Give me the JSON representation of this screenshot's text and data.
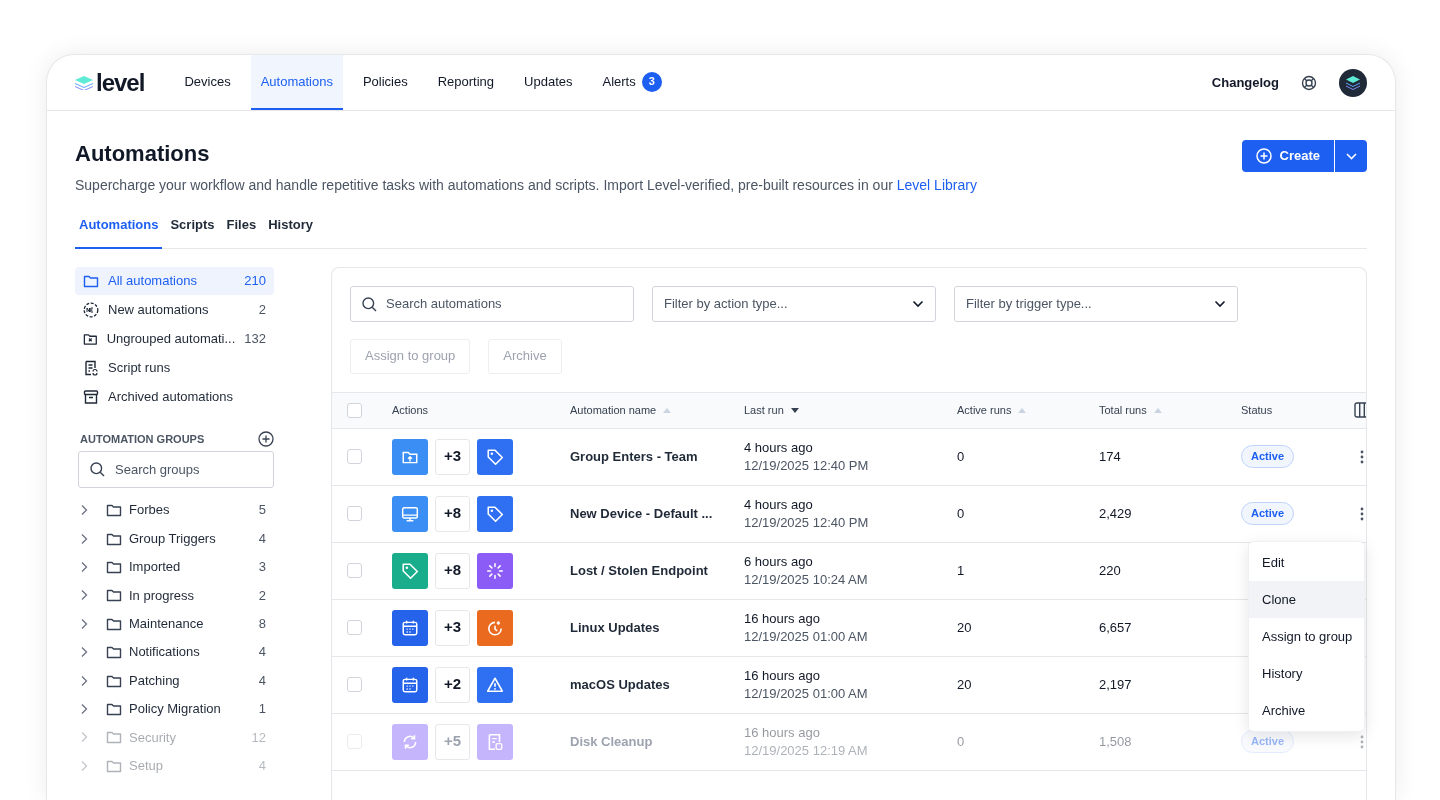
{
  "logo": {
    "text": "level"
  },
  "nav": {
    "items": [
      {
        "label": "Devices",
        "selected": false
      },
      {
        "label": "Automations",
        "selected": true
      },
      {
        "label": "Policies",
        "selected": false
      },
      {
        "label": "Reporting",
        "selected": false
      },
      {
        "label": "Updates",
        "selected": false
      },
      {
        "label": "Alerts",
        "selected": false,
        "badge": "3"
      }
    ],
    "changelog": "Changelog"
  },
  "header": {
    "title": "Automations",
    "subtitle": "Supercharge your workflow and handle repetitive tasks with automations and scripts. Import Level-verified, pre-built resources in our ",
    "link": "Level Library",
    "create": "Create"
  },
  "tabs": [
    {
      "label": "Automations",
      "selected": true
    },
    {
      "label": "Scripts",
      "selected": false
    },
    {
      "label": "Files",
      "selected": false
    },
    {
      "label": "History",
      "selected": false
    }
  ],
  "sidebar": {
    "items": [
      {
        "label": "All automations",
        "count": "210",
        "selected": true,
        "kind": "folder"
      },
      {
        "label": "New automations",
        "count": "2",
        "selected": false,
        "kind": "new"
      },
      {
        "label": "Ungrouped automati...",
        "count": "132",
        "selected": false,
        "kind": "ungrouped"
      },
      {
        "label": "Script runs",
        "selected": false,
        "kind": "script"
      },
      {
        "label": "Archived automations",
        "selected": false,
        "kind": "archive"
      }
    ],
    "groups_heading": "AUTOMATION GROUPS",
    "group_search": {
      "placeholder": "Search groups"
    },
    "groups": [
      {
        "label": "Forbes",
        "count": "5",
        "dimmed": false
      },
      {
        "label": "Group Triggers",
        "count": "4",
        "dimmed": false
      },
      {
        "label": "Imported",
        "count": "3",
        "dimmed": false
      },
      {
        "label": "In progress",
        "count": "2",
        "dimmed": false
      },
      {
        "label": "Maintenance",
        "count": "8",
        "dimmed": false
      },
      {
        "label": "Notifications",
        "count": "4",
        "dimmed": false
      },
      {
        "label": "Patching",
        "count": "4",
        "dimmed": false
      },
      {
        "label": "Policy Migration",
        "count": "1",
        "dimmed": false
      },
      {
        "label": "Security",
        "count": "12",
        "dimmed": true
      },
      {
        "label": "Setup",
        "count": "4",
        "dimmed": true
      }
    ]
  },
  "toolbar": {
    "search": {
      "placeholder": "Search automations"
    },
    "filters": [
      {
        "placeholder": "Filter by action type..."
      },
      {
        "placeholder": "Filter by trigger type..."
      }
    ],
    "buttons": [
      {
        "label": "Assign to group",
        "disabled": true
      },
      {
        "label": "Archive",
        "disabled": true
      }
    ]
  },
  "table": {
    "header_checked": false,
    "columns": [
      {
        "label": "Actions"
      },
      {
        "label": "Automation name",
        "sorted": false
      },
      {
        "label": "Last run",
        "sorted": true
      },
      {
        "label": "Active runs",
        "sorted": false
      },
      {
        "label": "Total runs",
        "sorted": false
      },
      {
        "label": "Status"
      }
    ],
    "rows": [
      {
        "checked": false,
        "dimmed": false,
        "actions": [
          {
            "kind": "folder",
            "color": "#3b8ef3"
          },
          {
            "kind": "more",
            "label": "+3"
          },
          {
            "kind": "tag",
            "color": "#2f6ff2"
          }
        ],
        "name": "Group Enters - Team",
        "last_run": "4 hours ago",
        "last_run_date": "12/19/2025 12:40 PM",
        "active_runs": "0",
        "total_runs": "174",
        "status": "Active"
      },
      {
        "checked": false,
        "dimmed": false,
        "actions": [
          {
            "kind": "monitor",
            "color": "#3b8ef3"
          },
          {
            "kind": "more",
            "label": "+8"
          },
          {
            "kind": "tag",
            "color": "#2f6ff2"
          }
        ],
        "name": "New Device - Default ...",
        "last_run": "4 hours ago",
        "last_run_date": "12/19/2025 12:40 PM",
        "active_runs": "0",
        "total_runs": "2,429",
        "status": "Active"
      },
      {
        "checked": false,
        "dimmed": false,
        "actions": [
          {
            "kind": "tag",
            "color": "#19ad8c"
          },
          {
            "kind": "more",
            "label": "+8"
          },
          {
            "kind": "spinner",
            "color": "#8b5cf6"
          }
        ],
        "name": "Lost / Stolen Endpoint",
        "last_run": "6 hours ago",
        "last_run_date": "12/19/2025 10:24 AM",
        "active_runs": "1",
        "total_runs": "220"
      },
      {
        "checked": false,
        "dimmed": false,
        "actions": [
          {
            "kind": "calendar",
            "color": "#2563eb"
          },
          {
            "kind": "more",
            "label": "+3"
          },
          {
            "kind": "timer",
            "color": "#ea6a1f"
          }
        ],
        "name": "Linux Updates",
        "last_run": "16 hours ago",
        "last_run_date": "12/19/2025 01:00 AM",
        "active_runs": "20",
        "total_runs": "6,657"
      },
      {
        "checked": false,
        "dimmed": false,
        "actions": [
          {
            "kind": "calendar",
            "color": "#2563eb"
          },
          {
            "kind": "more",
            "label": "+2"
          },
          {
            "kind": "warning",
            "color": "#2f6ff2"
          }
        ],
        "name": "macOS Updates",
        "last_run": "16 hours ago",
        "last_run_date": "12/19/2025 01:00 AM",
        "active_runs": "20",
        "total_runs": "2,197"
      },
      {
        "checked": false,
        "dimmed": true,
        "actions": [
          {
            "kind": "refresh",
            "color": "#c4b5fd"
          },
          {
            "kind": "more",
            "label": "+5"
          },
          {
            "kind": "script",
            "color": "#c4b5fd"
          }
        ],
        "name": "Disk Cleanup",
        "last_run": "16 hours ago",
        "last_run_date": "12/19/2025 12:19 AM",
        "active_runs": "0",
        "total_runs": "1,508",
        "status": "Active"
      }
    ]
  },
  "menu": {
    "items": [
      {
        "label": "Edit",
        "hovered": false
      },
      {
        "label": "Clone",
        "hovered": true
      },
      {
        "label": "Assign to group",
        "hovered": false
      },
      {
        "label": "History",
        "hovered": false
      },
      {
        "label": "Archive",
        "hovered": false
      }
    ]
  }
}
